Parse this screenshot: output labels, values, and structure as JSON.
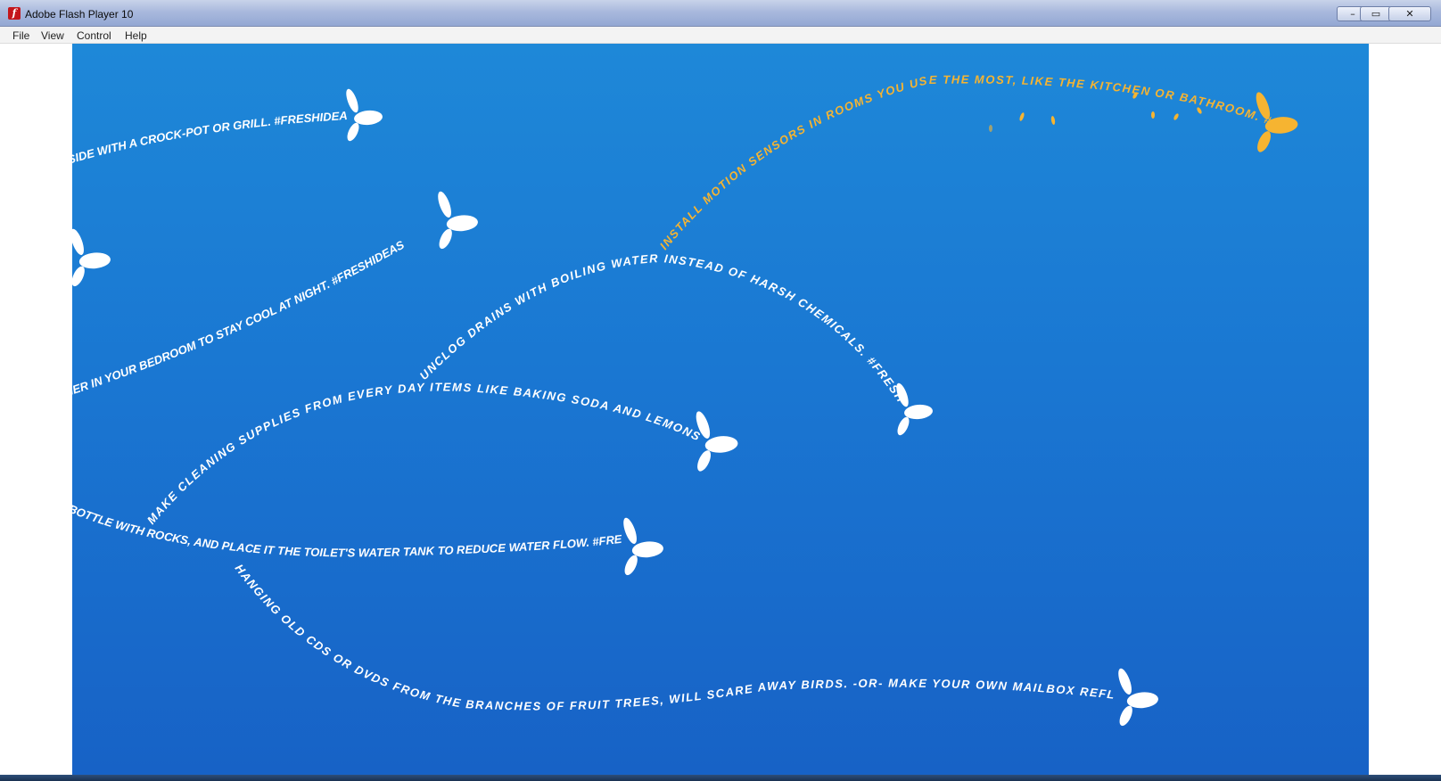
{
  "window": {
    "title": "Adobe Flash Player 10",
    "icon": "flash-app-icon"
  },
  "window_controls": {
    "minimize": "–",
    "maximize": "▭",
    "close": "✕"
  },
  "menu": {
    "items": [
      "File",
      "View",
      "Control",
      "Help"
    ]
  },
  "stage": {
    "colors": {
      "background_top": "#1e88d8",
      "background_bottom": "#1762c6",
      "text": "#ffffff",
      "highlight": "#f6b431"
    },
    "quotes": [
      "UTSIDE WITH A CROCK-POT OR GRILL. #FRESHIDEAS",
      "IONER IN YOUR BEDROOM TO STAY COOL AT NIGHT. #FRESHIDEAS",
      "INSTALL MOTION SENSORS IN ROOMS YOU USE THE MOST, LIKE THE KITCHEN OR BATHROOM. #FRESHIDEAS",
      "UNCLOG DRAINS WITH BOILING WATER INSTEAD OF HARSH CHEMICALS. #FRESHIDEAS",
      "MAKE CLEANING SUPPLIES FROM EVERY DAY ITEMS LIKE BAKING SODA AND LEMONS. #FRESHIDEAS",
      "BOTTLE WITH ROCKS, AND PLACE IT THE TOILET'S WATER TANK TO REDUCE WATER FLOW. #FRESHIDEAS",
      "HANGING OLD CDS OR DVDS FROM THE BRANCHES OF FRUIT TREES, WILL SCARE AWAY BIRDS. -OR- MAKE YOUR OWN MAILBOX REFLECTORS FROM OLD CDS OR DVDS."
    ]
  }
}
